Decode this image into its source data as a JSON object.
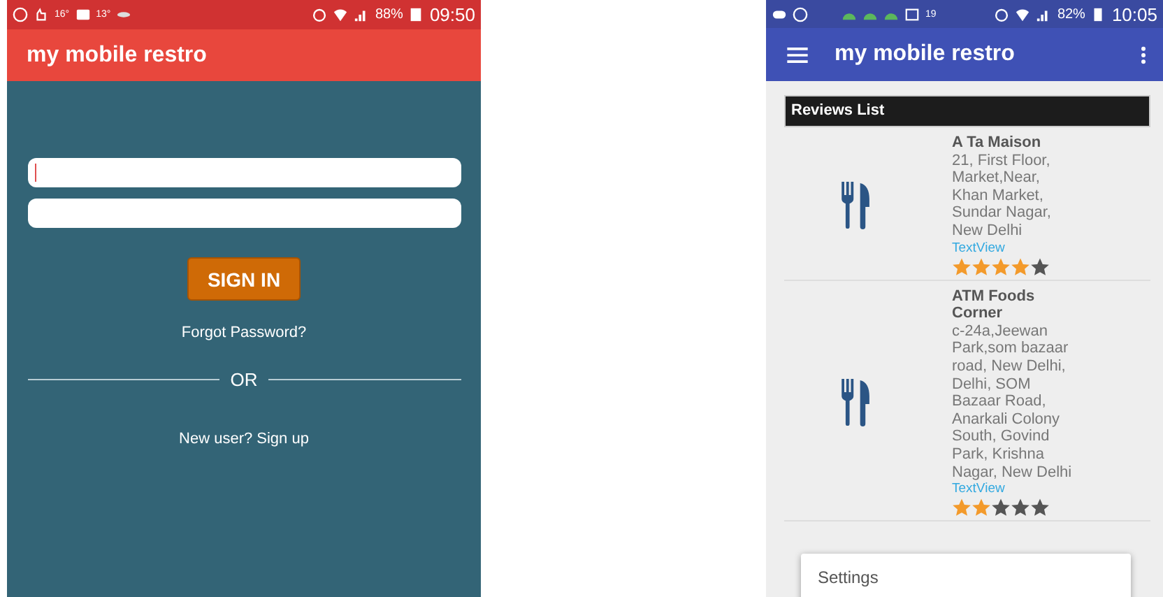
{
  "login_screen": {
    "status_bar": {
      "temp_1": "16°",
      "temp_2": "13°",
      "battery": "88%",
      "time": "09:50"
    },
    "app_bar": {
      "title": "my mobile restro"
    },
    "fields": [
      {
        "focused": true
      },
      {
        "focused": false
      }
    ],
    "sign_in_button": "SIGN IN",
    "forgot_link": "Forgot Password?",
    "divider_label": "OR",
    "signup_link": "New user? Sign up"
  },
  "reviews_screen": {
    "status_bar": {
      "temp": "19",
      "battery": "82%",
      "time": "10:05"
    },
    "app_bar": {
      "title": "my mobile restro"
    },
    "list_header": "Reviews List",
    "reviews": [
      {
        "name": "A Ta Maison",
        "address": "21, First Floor, Market,Near, Khan Market, Sundar Nagar, New Delhi",
        "link": "TextView",
        "stars": 4
      },
      {
        "name": "ATM Foods Corner",
        "address": "c-24a,Jeewan Park,som bazaar road, New Delhi, Delhi, SOM Bazaar Road, Anarkali Colony South, Govind Park, Krishna Nagar, New Delhi",
        "link": "TextView",
        "stars": 2
      }
    ],
    "menu": [
      {
        "label": "Settings"
      }
    ]
  }
}
